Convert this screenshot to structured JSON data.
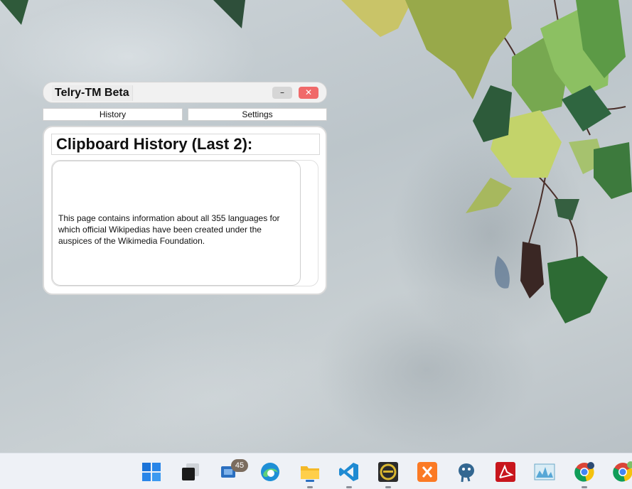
{
  "window": {
    "title": "Telry-TM Beta",
    "minimize_label": "–",
    "close_label": "✕"
  },
  "tabs": [
    {
      "label": "History"
    },
    {
      "label": "Settings"
    }
  ],
  "history": {
    "heading": "Clipboard History (Last 2):",
    "items": [
      {
        "text": "This page contains information about all 355 languages for which official Wikipedias have been created under the auspices of the Wikimedia Foundation."
      }
    ]
  },
  "taskbar": {
    "icons": [
      "windows-start-icon",
      "task-view-icon",
      "widgets-icon",
      "edge-icon",
      "file-explorer-icon",
      "vscode-icon",
      "eclipse-icon",
      "xampp-icon",
      "postgresql-icon",
      "acrobat-icon",
      "performance-monitor-icon",
      "chrome-icon",
      "chrome-profile-icon"
    ],
    "badge_count": "45"
  },
  "colors": {
    "close_button": "#f06a6a",
    "panel_bg": "#ffffff",
    "taskbar_bg": "#eef1f6"
  }
}
